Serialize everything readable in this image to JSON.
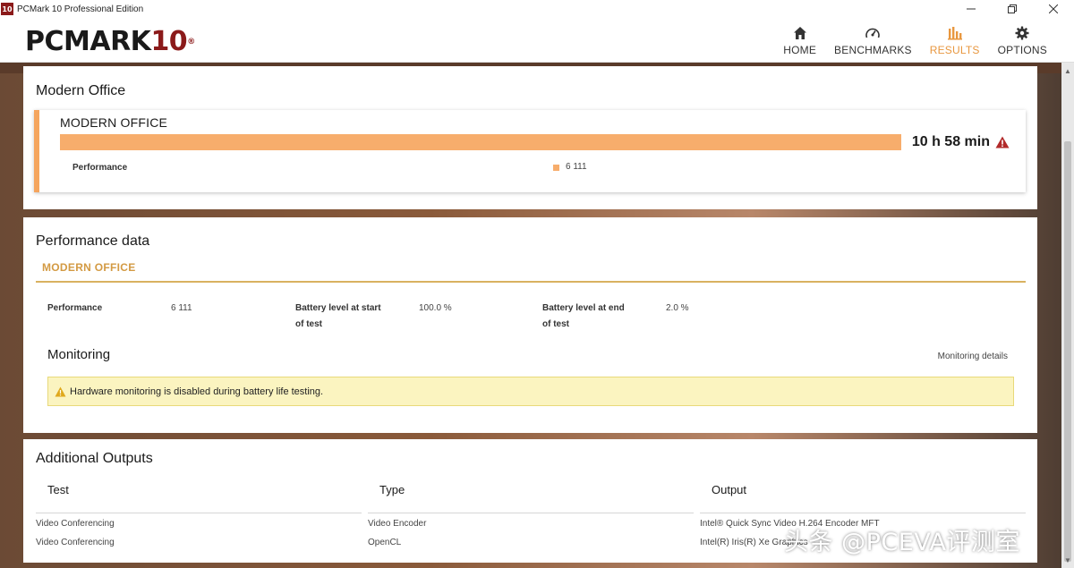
{
  "window": {
    "icon_text": "10",
    "title": "PCMark 10 Professional Edition",
    "controls": [
      "minimize-icon",
      "restore-icon",
      "close-icon"
    ]
  },
  "header": {
    "logo_main": "PCMARK",
    "logo_num": "10",
    "logo_reg": "®",
    "nav": [
      {
        "label": "HOME",
        "icon": "home-icon",
        "active": false
      },
      {
        "label": "BENCHMARKS",
        "icon": "speedometer-icon",
        "active": false
      },
      {
        "label": "RESULTS",
        "icon": "bar-chart-icon",
        "active": true
      },
      {
        "label": "OPTIONS",
        "icon": "gear-icon",
        "active": false
      }
    ],
    "active_color": "#e8973f"
  },
  "modern_office": {
    "title": "Modern Office",
    "card_title": "MODERN OFFICE",
    "score": "10 h 58 min",
    "bar_color": "#f7ad6c",
    "perf_label": "Performance",
    "perf_value": "6 111"
  },
  "performance_data": {
    "title": "Performance data",
    "tab": "MODERN OFFICE",
    "items": [
      {
        "label": "Performance",
        "value": "6 111"
      },
      {
        "label_line1": "Battery level at start",
        "label_line2": "of test",
        "value": "100.0 %"
      },
      {
        "label_line1": "Battery level at end",
        "label_line2": "of test",
        "value": "2.0 %"
      }
    ],
    "monitoring_title": "Monitoring",
    "monitoring_details": "Monitoring details",
    "alert": "Hardware monitoring is disabled during battery life testing."
  },
  "additional_outputs": {
    "title": "Additional Outputs",
    "columns": [
      "Test",
      "Type",
      "Output"
    ],
    "rows": [
      [
        "Video Conferencing",
        "Video Encoder",
        "Intel® Quick Sync Video H.264 Encoder MFT"
      ],
      [
        "Video Conferencing",
        "OpenCL",
        "Intel(R) Iris(R) Xe Graphics"
      ]
    ]
  },
  "watermark": "头条 @PCEVA评测室"
}
